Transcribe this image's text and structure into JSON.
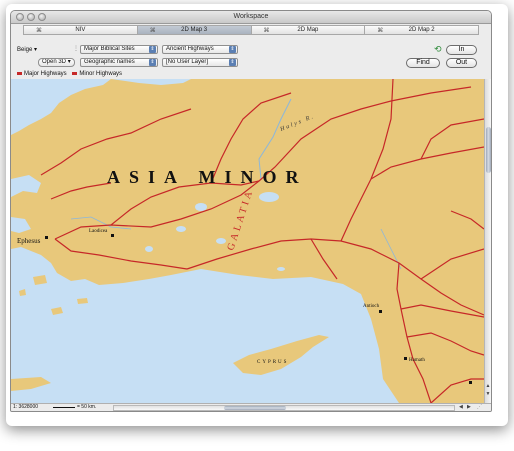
{
  "window": {
    "title": "Workspace"
  },
  "tabs": [
    {
      "label": "NIV"
    },
    {
      "label": "2D Map 3"
    },
    {
      "label": "2D Map"
    },
    {
      "label": "2D Map 2"
    }
  ],
  "toolbar": {
    "color_scheme": "Beige",
    "open3d_label": "Open 3D",
    "select_sites": "Major Biblical Sites",
    "select_highways": "Ancient Highways",
    "select_names": "Geographic names",
    "select_user_layer": "[No User Layer]",
    "in_label": "In",
    "find_label": "Find",
    "out_label": "Out"
  },
  "legend": {
    "major": "Major Highways",
    "minor": "Minor Highways"
  },
  "map": {
    "region_title": "ASIA MINOR",
    "province_label": "GALATIA",
    "cities": {
      "ephesus": "Ephesus",
      "laodicea": "Laodicea",
      "antioch": "Antioch",
      "hamath": "Hamath"
    },
    "island_label": "CYPRUS",
    "river_label": "Halys R."
  },
  "status": {
    "scale": "1: 3628000",
    "scalebar_label": "= 50 km."
  },
  "colors": {
    "land": "#e8c87b",
    "sea": "#c6dff4",
    "highway": "#c62828"
  }
}
